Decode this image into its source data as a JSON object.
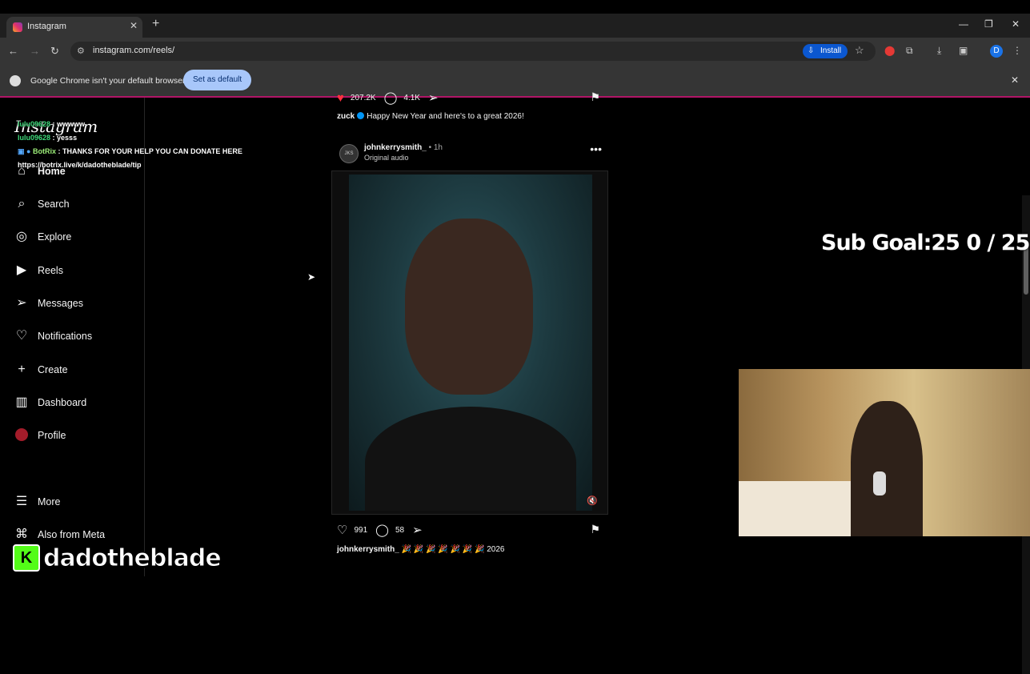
{
  "browser": {
    "tab_title": "Instagram",
    "tab_close": "✕",
    "new_tab": "+",
    "url": "instagram.com/reels/",
    "install_label": "Install",
    "profile_initial": "D",
    "window_controls": [
      "—",
      "❐",
      "✕"
    ]
  },
  "infobar": {
    "message": "Google Chrome isn't your default browser",
    "button": "Set as default"
  },
  "instagram": {
    "logo": "Instagram",
    "nav": [
      {
        "label": "Home",
        "icon": "⌂"
      },
      {
        "label": "Search",
        "icon": "⌕"
      },
      {
        "label": "Explore",
        "icon": "◎"
      },
      {
        "label": "Reels",
        "icon": "▶"
      },
      {
        "label": "Messages",
        "icon": "➢"
      },
      {
        "label": "Notifications",
        "icon": "♡"
      },
      {
        "label": "Create",
        "icon": "+"
      },
      {
        "label": "Dashboard",
        "icon": "▥"
      },
      {
        "label": "Profile",
        "icon": ""
      },
      {
        "label": "More",
        "icon": "☰"
      },
      {
        "label": "Also from Meta",
        "icon": "⌘"
      }
    ],
    "prev_post": {
      "likes": "207.2K",
      "comments": "4.1K",
      "caption_user": "zuck",
      "caption_text": "Happy New Year and here's to a great 2026!"
    },
    "post": {
      "username": "johnkerrysmith_",
      "time": "• 1h",
      "audio": "Original audio",
      "likes": "991",
      "comments": "58",
      "caption_user": "johnkerrysmith_",
      "caption_text": "🎉 🎉 🎉 🎉 🎉 🎉 🎉 2026"
    }
  },
  "chat": [
    {
      "user": "lulu09628",
      "msg": ": wwwww"
    },
    {
      "user": "lulu09628",
      "msg": ": yesss"
    },
    {
      "user": "BotRix",
      "msg": ": THANKS FOR YOUR HELP YOU CAN DONATE HERE"
    },
    {
      "user": "",
      "msg": "https://botrix.live/k/dadotheblade/tip"
    }
  ],
  "stream": {
    "sub_goal": "Sub Goal:25  0 / 25",
    "streamer_name": "dadotheblade",
    "platform_icon": "K"
  }
}
